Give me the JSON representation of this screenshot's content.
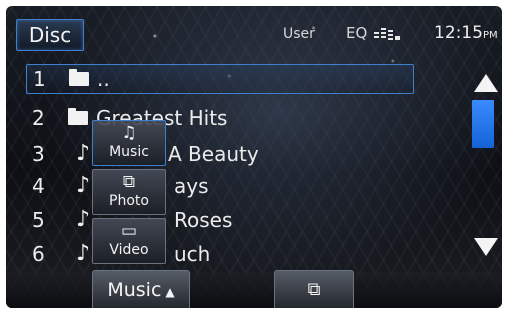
{
  "header": {
    "source_label": "Disc",
    "user_label": "User",
    "eq_label": "EQ",
    "eq_icon": "equalizer-icon",
    "time": "12:15",
    "time_suffix": "PM"
  },
  "list": {
    "rows": [
      {
        "number": "1",
        "type": "folder",
        "label": ".."
      },
      {
        "number": "2",
        "type": "folder",
        "label": "Greatest Hits"
      },
      {
        "number": "3",
        "type": "track",
        "label": "A Beauty"
      },
      {
        "number": "4",
        "type": "track",
        "label": "ays"
      },
      {
        "number": "5",
        "type": "track",
        "label": "Roses"
      },
      {
        "number": "6",
        "type": "track",
        "label": "uch"
      }
    ],
    "selected_index": 0
  },
  "filter_menu": {
    "items": [
      {
        "icon": "music-note-icon",
        "glyph": "♫",
        "label": "Music"
      },
      {
        "icon": "photo-icon",
        "glyph": "⧉",
        "label": "Photo"
      },
      {
        "icon": "video-icon",
        "glyph": "▭",
        "label": "Video"
      }
    ]
  },
  "scrollbar": {
    "up_icon": "scroll-up-arrow-icon",
    "down_icon": "scroll-down-arrow-icon",
    "accent_color": "#1a6ff0"
  },
  "bottom_bar": {
    "media_button_label": "Music",
    "media_button_arrow": "▲",
    "window_button_glyph": "⧉",
    "window_button_icon": "window-switch-icon"
  },
  "colors": {
    "accent_blue": "#3f7fd0",
    "text": "#f0f0f0"
  }
}
